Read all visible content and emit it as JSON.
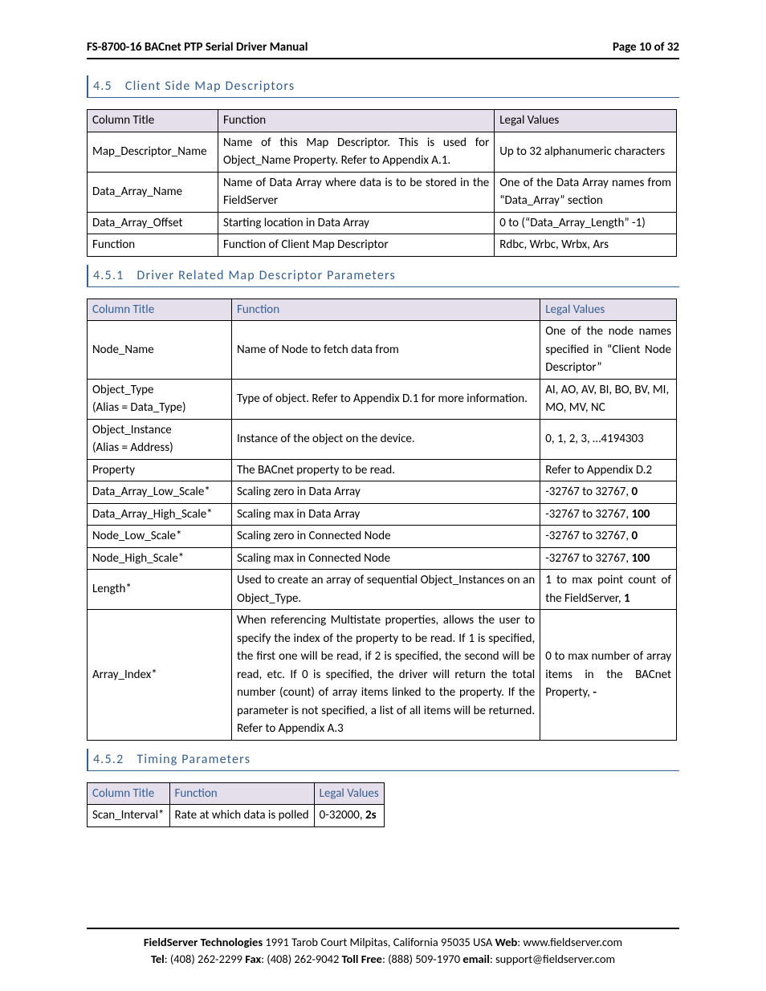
{
  "header": {
    "title": "FS-8700-16 BACnet PTP Serial Driver Manual",
    "page": "Page 10 of 32"
  },
  "section45": {
    "num": "4.5",
    "title": "Client Side Map Descriptors"
  },
  "table1": {
    "headers": [
      "Column Title",
      "Function",
      "Legal Values"
    ],
    "rows": [
      {
        "c1": "Map_Descriptor_Name",
        "c2": "Name of this Map Descriptor.  This is used for Object_Name Property.  Refer to Appendix A.1.",
        "c3": "Up to 32 alphanumeric characters"
      },
      {
        "c1": "Data_Array_Name",
        "c2": "Name of Data Array where data is to be stored in the FieldServer",
        "c3": "One of the Data Array names from “Data_Array” section"
      },
      {
        "c1": "Data_Array_Offset",
        "c2": "Starting location in Data Array",
        "c3": "0 to (“Data_Array_Length” -1)"
      },
      {
        "c1": "Function",
        "c2": "Function of Client Map Descriptor",
        "c3": "Rdbc, Wrbc, Wrbx, Ars"
      }
    ]
  },
  "section451": {
    "num": "4.5.1",
    "title": "Driver Related Map Descriptor Parameters"
  },
  "table2": {
    "headers": [
      "Column Title",
      "Function",
      "Legal Values"
    ],
    "rows": [
      {
        "c1": "Node_Name",
        "c2": "Name of Node to fetch data from",
        "c3": "One of the node names specified in “Client Node Descriptor”"
      },
      {
        "c1a": "Object_Type",
        "c1b": "(Alias = Data_Type)",
        "c2": "Type of object.  Refer to Appendix D.1 for more information.",
        "c3": "AI, AO, AV, BI, BO, BV, MI, MO, MV, NC"
      },
      {
        "c1a": "Object_Instance",
        "c1b": "(Alias = Address)",
        "c2": "Instance of the object on the device.",
        "c3": "0, 1, 2, 3, …4194303"
      },
      {
        "c1": "Property",
        "c2": "The BACnet property to be read.",
        "c3": "Refer to Appendix D.2"
      },
      {
        "c1": "Data_Array_Low_Scale*",
        "c2": "Scaling zero in Data Array",
        "c3pre": "-32767 to 32767, ",
        "c3b": "0"
      },
      {
        "c1": "Data_Array_High_Scale*",
        "c2": "Scaling max in Data Array",
        "c3pre": "-32767 to 32767, ",
        "c3b": "100"
      },
      {
        "c1": "Node_Low_Scale*",
        "c2": "Scaling zero in Connected Node",
        "c3pre": "-32767 to 32767, ",
        "c3b": "0"
      },
      {
        "c1": "Node_High_Scale*",
        "c2": "Scaling max in Connected Node",
        "c3pre": "-32767 to 32767, ",
        "c3b": "100"
      },
      {
        "c1": "Length*",
        "c2": "Used to create an array of sequential Object_Instances on an Object_Type.",
        "c3pre": "1 to max point count of the FieldServer, ",
        "c3b": "1"
      },
      {
        "c1": "Array_Index*",
        "c2": "When referencing Multistate properties, allows the user to specify the index of the property to be read.  If 1 is specified, the first one will be read, if 2 is specified, the second will be read, etc.  If 0 is specified, the driver will return the total number (count) of array items linked to the property.  If the parameter is not specified, a list of all items will be returned.   Refer to Appendix A.3",
        "c3pre": "0 to max number of array items in the BACnet Property, ",
        "c3b": "-"
      }
    ]
  },
  "section452": {
    "num": "4.5.2",
    "title": "Timing Parameters"
  },
  "table3": {
    "headers": [
      "Column Title",
      "Function",
      "Legal Values"
    ],
    "row": {
      "c1": "Scan_Interval*",
      "c2": "Rate at which data is polled",
      "c3pre": "0-32000, ",
      "c3b": "2s"
    }
  },
  "footer": {
    "company": "FieldServer Technologies",
    "addr": " 1991 Tarob Court Milpitas, California 95035 USA   ",
    "web_l": "Web",
    "web_v": ": www.fieldserver.com",
    "tel_l": "Tel",
    "tel_v": ": (408) 262-2299   ",
    "fax_l": "Fax",
    "fax_v": ": (408) 262-9042   ",
    "toll_l": "Toll Free",
    "toll_v": ": (888) 509-1970   ",
    "email_l": "email",
    "email_v": ": support@fieldserver.com"
  }
}
